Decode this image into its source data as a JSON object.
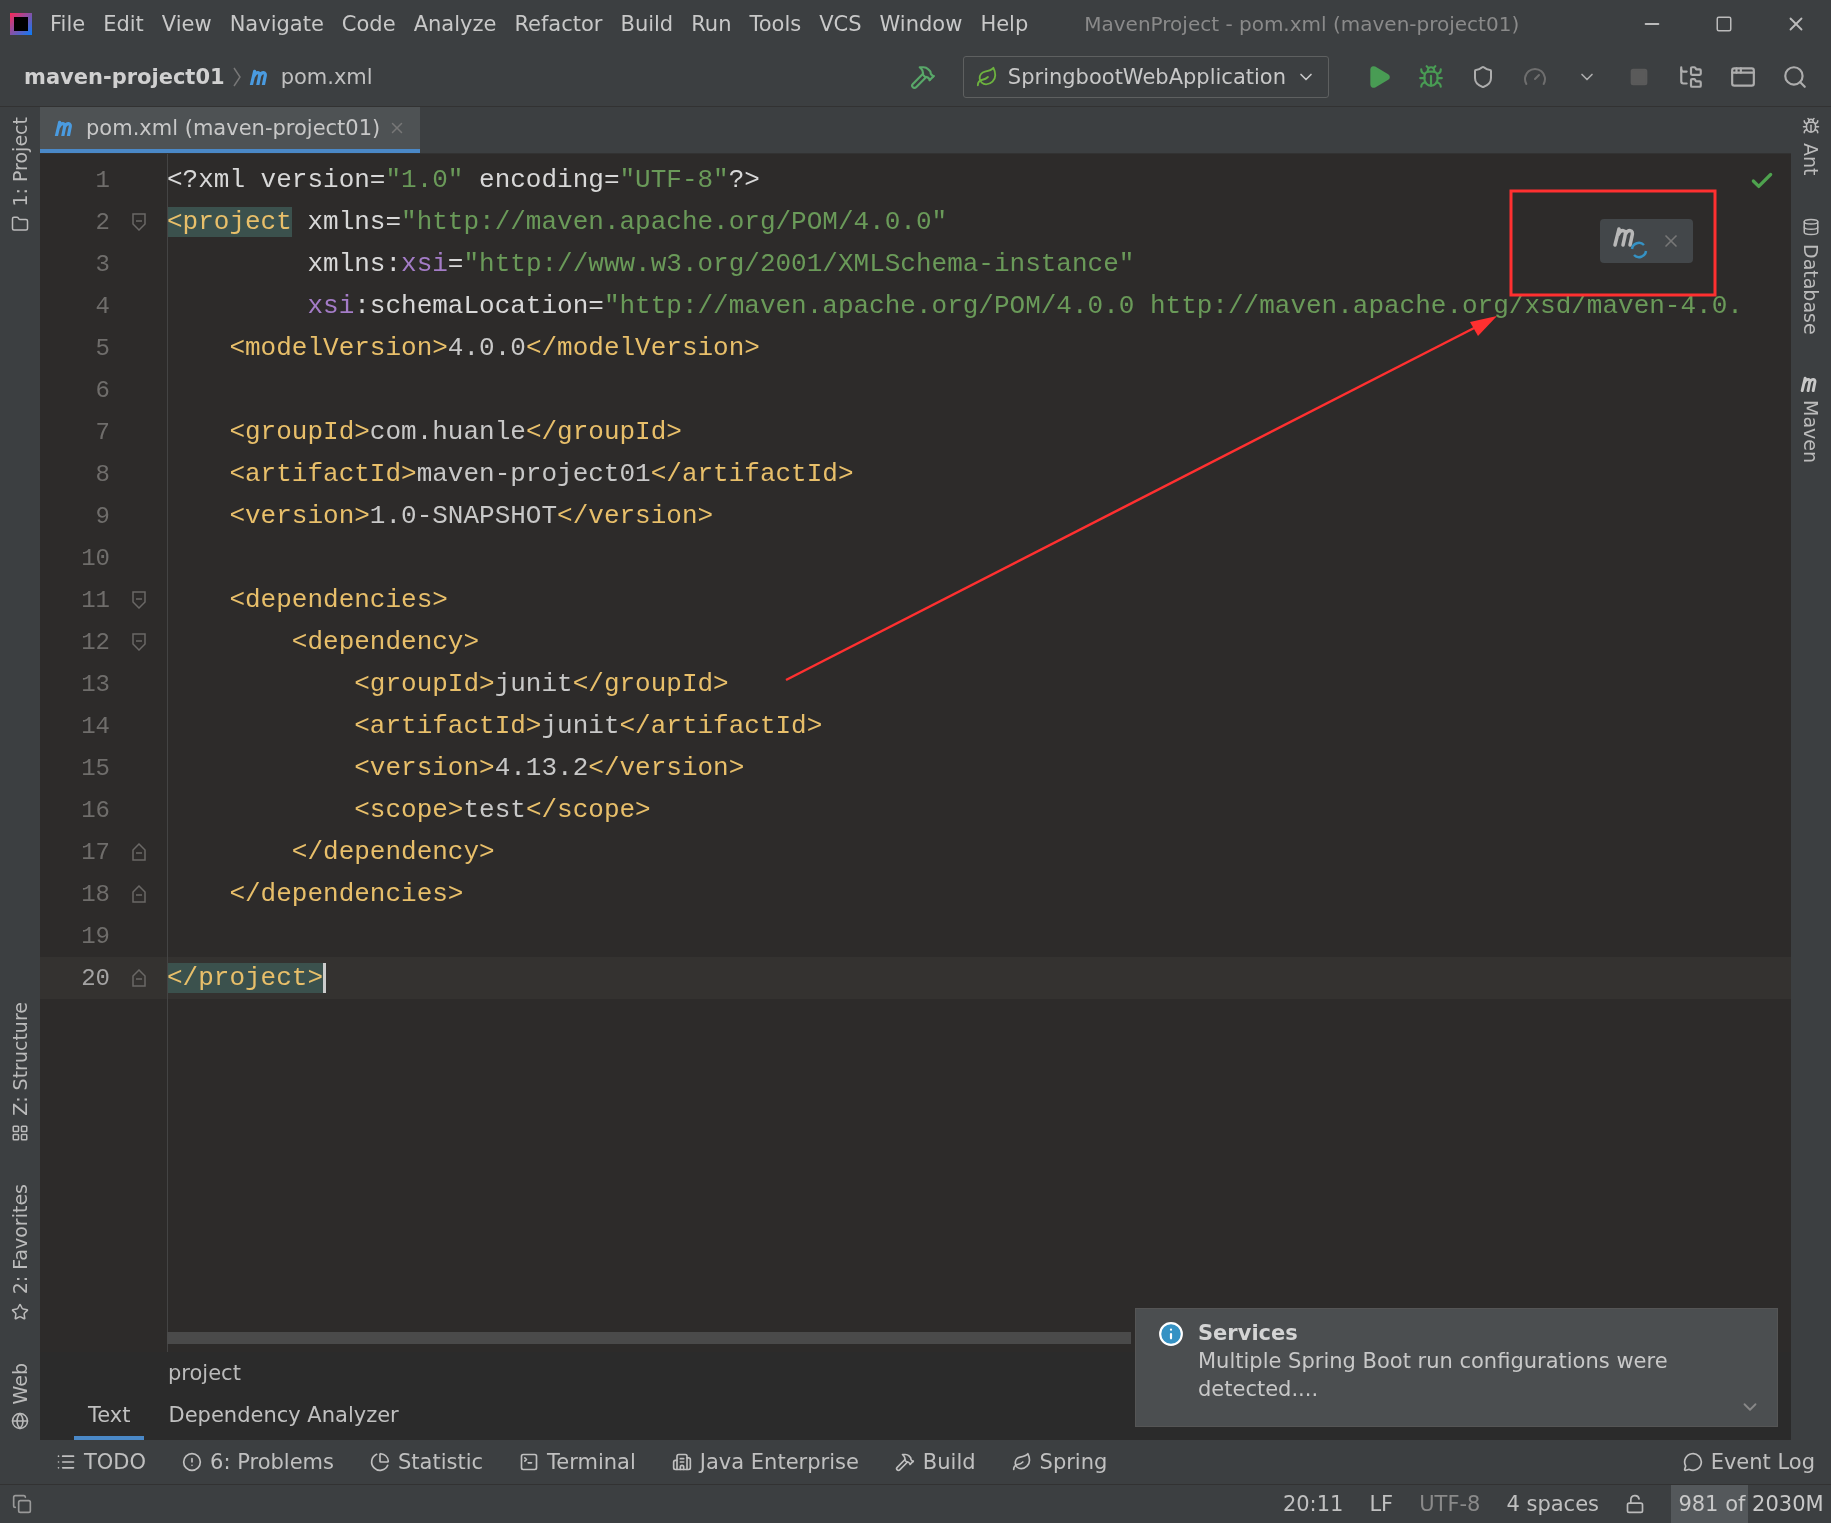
{
  "menu_bar": {
    "items": [
      "File",
      "Edit",
      "View",
      "Navigate",
      "Code",
      "Analyze",
      "Refactor",
      "Build",
      "Run",
      "Tools",
      "VCS",
      "Window",
      "Help"
    ],
    "title": "MavenProject - pom.xml (maven-project01)"
  },
  "navigation_bar": {
    "breadcrumbs": [
      "maven-project01",
      "pom.xml"
    ],
    "run_configuration": "SpringbootWebApplication"
  },
  "editor_tabs": [
    {
      "label": "pom.xml (maven-project01)",
      "selected": true
    }
  ],
  "left_tool_strip": {
    "top": [
      {
        "label": "1: Project",
        "kind": "project"
      }
    ],
    "bottom": [
      {
        "label": "Z: Structure",
        "kind": "structure"
      },
      {
        "label": "2: Favorites",
        "kind": "favorites"
      },
      {
        "label": "Web",
        "kind": "web"
      }
    ]
  },
  "right_tool_strip": [
    {
      "label": "Ant",
      "kind": "ant"
    },
    {
      "label": "Database",
      "kind": "database"
    },
    {
      "label": "Maven",
      "kind": "maven"
    }
  ],
  "editor": {
    "lines": [
      {
        "number": "1",
        "fold_start": false,
        "fold_end": false,
        "current": false,
        "tokens": [
          {
            "kind": "attr",
            "t": "<?xml version="
          },
          {
            "kind": "str",
            "t": "\"1.0\""
          },
          {
            "kind": "attr",
            "t": " encoding="
          },
          {
            "kind": "str",
            "t": "\"UTF-8\""
          },
          {
            "kind": "attr",
            "t": "?>"
          }
        ]
      },
      {
        "number": "2",
        "fold_start": true,
        "fold_end": false,
        "current": false,
        "tokens": [
          {
            "kind": "match",
            "t": "<project"
          },
          {
            "kind": "attr",
            "t": " xmlns="
          },
          {
            "kind": "str",
            "t": "\"http://maven.apache.org/POM/4.0.0\""
          }
        ]
      },
      {
        "number": "3",
        "fold_start": false,
        "fold_end": false,
        "current": false,
        "tokens": [
          {
            "kind": "attr",
            "t": "         xmlns:"
          },
          {
            "kind": "ns",
            "t": "xsi"
          },
          {
            "kind": "attr",
            "t": "="
          },
          {
            "kind": "str",
            "t": "\"http://www.w3.org/2001/XMLSchema-instance\""
          }
        ]
      },
      {
        "number": "4",
        "fold_start": false,
        "fold_end": false,
        "current": false,
        "tokens": [
          {
            "kind": "ns",
            "t": "         xsi"
          },
          {
            "kind": "attr",
            "t": ":schemaLocation="
          },
          {
            "kind": "str",
            "t": "\"http://maven.apache.org/POM/4.0.0 http://maven.apache.org/xsd/maven-4.0."
          }
        ]
      },
      {
        "number": "5",
        "fold_start": false,
        "fold_end": false,
        "current": false,
        "tokens": [
          {
            "kind": "tag",
            "t": "    <modelVersion>"
          },
          {
            "kind": "text",
            "t": "4.0.0"
          },
          {
            "kind": "tag",
            "t": "</modelVersion>"
          }
        ]
      },
      {
        "number": "6",
        "fold_start": false,
        "fold_end": false,
        "current": false
      },
      {
        "number": "7",
        "fold_start": false,
        "fold_end": false,
        "current": false,
        "tokens": [
          {
            "kind": "tag",
            "t": "    <groupId>"
          },
          {
            "kind": "text",
            "t": "com.huanle"
          },
          {
            "kind": "tag",
            "t": "</groupId>"
          }
        ]
      },
      {
        "number": "8",
        "fold_start": false,
        "fold_end": false,
        "current": false,
        "tokens": [
          {
            "kind": "tag",
            "t": "    <artifactId>"
          },
          {
            "kind": "text",
            "t": "maven-project01"
          },
          {
            "kind": "tag",
            "t": "</artifactId>"
          }
        ]
      },
      {
        "number": "9",
        "fold_start": false,
        "fold_end": false,
        "current": false,
        "tokens": [
          {
            "kind": "tag",
            "t": "    <version>"
          },
          {
            "kind": "text",
            "t": "1.0-SNAPSHOT"
          },
          {
            "kind": "tag",
            "t": "</version>"
          }
        ]
      },
      {
        "number": "10",
        "fold_start": false,
        "fold_end": false,
        "current": false
      },
      {
        "number": "11",
        "fold_start": true,
        "fold_end": false,
        "current": false,
        "tokens": [
          {
            "kind": "tag",
            "t": "    <dependencies>"
          }
        ]
      },
      {
        "number": "12",
        "fold_start": true,
        "fold_end": false,
        "current": false,
        "tokens": [
          {
            "kind": "tag",
            "t": "        <dependency>"
          }
        ]
      },
      {
        "number": "13",
        "fold_start": false,
        "fold_end": false,
        "current": false,
        "tokens": [
          {
            "kind": "tag",
            "t": "            <groupId>"
          },
          {
            "kind": "text",
            "t": "junit"
          },
          {
            "kind": "tag",
            "t": "</groupId>"
          }
        ]
      },
      {
        "number": "14",
        "fold_start": false,
        "fold_end": false,
        "current": false,
        "tokens": [
          {
            "kind": "tag",
            "t": "            <artifactId>"
          },
          {
            "kind": "text",
            "t": "junit"
          },
          {
            "kind": "tag",
            "t": "</artifactId>"
          }
        ]
      },
      {
        "number": "15",
        "fold_start": false,
        "fold_end": false,
        "current": false,
        "tokens": [
          {
            "kind": "tag",
            "t": "            <version>"
          },
          {
            "kind": "text",
            "t": "4.13.2"
          },
          {
            "kind": "tag",
            "t": "</version>"
          }
        ]
      },
      {
        "number": "16",
        "fold_start": false,
        "fold_end": false,
        "current": false,
        "tokens": [
          {
            "kind": "tag",
            "t": "            <scope>"
          },
          {
            "kind": "text",
            "t": "test"
          },
          {
            "kind": "tag",
            "t": "</scope>"
          }
        ]
      },
      {
        "number": "17",
        "fold_start": false,
        "fold_end": true,
        "current": false,
        "tokens": [
          {
            "kind": "tag",
            "t": "        </dependency>"
          }
        ]
      },
      {
        "number": "18",
        "fold_start": false,
        "fold_end": true,
        "current": false,
        "tokens": [
          {
            "kind": "tag",
            "t": "    </dependencies>"
          }
        ]
      },
      {
        "number": "19",
        "fold_start": false,
        "fold_end": false,
        "current": false
      },
      {
        "number": "20",
        "fold_start": false,
        "fold_end": true,
        "current": true,
        "tokens": [
          {
            "kind": "match",
            "t": "</project>"
          }
        ]
      }
    ]
  },
  "breadcrumb": "project",
  "view_tabs": [
    {
      "label": "Text",
      "selected": true
    },
    {
      "label": "Dependency Analyzer",
      "selected": false
    }
  ],
  "tool_windows": [
    {
      "label": "TODO",
      "kind": "todo"
    },
    {
      "label": "6: Problems",
      "kind": "problems"
    },
    {
      "label": "Statistic",
      "kind": "statistic"
    },
    {
      "label": "Terminal",
      "kind": "terminal"
    },
    {
      "label": "Java Enterprise",
      "kind": "enterprise"
    },
    {
      "label": "Build",
      "kind": "build"
    },
    {
      "label": "Spring",
      "kind": "spring"
    }
  ],
  "event_log": "Event Log",
  "notification": {
    "title": "Services",
    "message": "Multiple Spring Boot run configurations were detected...."
  },
  "status_bar": {
    "caret": "20:11",
    "line_separator": "LF",
    "encoding": "UTF-8",
    "indent": "4 spaces",
    "memory": {
      "text": "981 of 2030M",
      "level": 0.48
    }
  }
}
